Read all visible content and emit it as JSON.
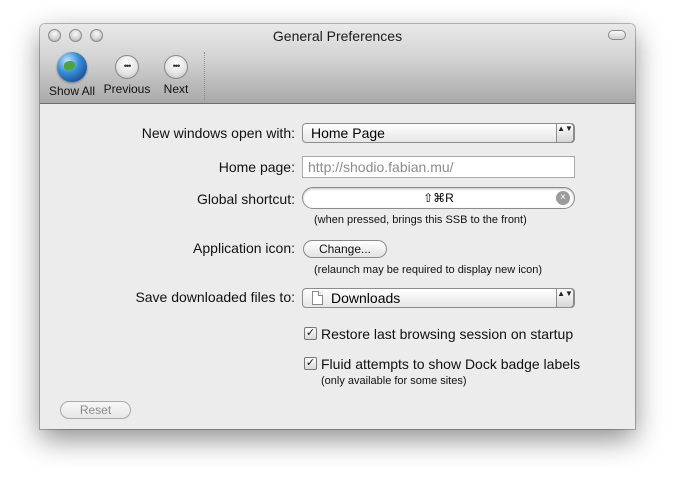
{
  "window": {
    "title": "General Preferences"
  },
  "toolbar": {
    "items": [
      {
        "label": "Show All",
        "icon": "globe-icon"
      },
      {
        "label": "Previous",
        "icon": "previous-icon"
      },
      {
        "label": "Next",
        "icon": "next-icon"
      }
    ]
  },
  "form": {
    "new_windows": {
      "label": "New windows open with:",
      "value": "Home Page"
    },
    "home_page": {
      "label": "Home page:",
      "value": "http://shodio.fabian.mu/"
    },
    "global_shortcut": {
      "label": "Global shortcut:",
      "value": "⇧⌘R",
      "hint": "(when pressed, brings this SSB to the front)"
    },
    "app_icon": {
      "label": "Application icon:",
      "button": "Change...",
      "hint": "(relaunch may be required to display new icon)"
    },
    "downloads": {
      "label": "Save downloaded files to:",
      "value": "Downloads"
    },
    "restore_session": {
      "label": "Restore last browsing session on startup",
      "checked": true
    },
    "dock_badge": {
      "label": "Fluid attempts to show Dock badge labels",
      "hint": "(only available for some sites)",
      "checked": true
    }
  },
  "reset_label": "Reset",
  "glyphs": {
    "check": "✓",
    "clear": "×",
    "updown": "▲▼",
    "nav_prev": "•••",
    "nav_next": "•••"
  }
}
